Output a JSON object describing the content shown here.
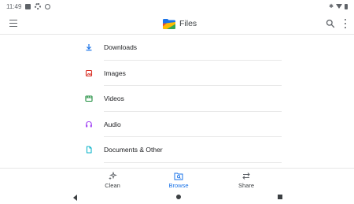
{
  "status_bar": {
    "time": "11:49",
    "left_icons": [
      "message-icon",
      "gear-icon",
      "at-icon"
    ],
    "right_icons": [
      "bluetooth-icon",
      "wifi-icon",
      "battery-icon"
    ]
  },
  "app_bar": {
    "title": "Files",
    "icons": [
      "menu-icon",
      "files-logo-icon",
      "search-icon",
      "more-vert-icon"
    ]
  },
  "colors": {
    "accent": "#1a73e8",
    "downloads": "#1a73e8",
    "images": "#d93025",
    "videos": "#1e8e3e",
    "audio": "#a142f4",
    "documents": "#12b5cb",
    "text": "#202124",
    "muted": "#5f6368"
  },
  "categories": [
    {
      "label": "Downloads",
      "icon": "download-icon"
    },
    {
      "label": "Images",
      "icon": "image-icon"
    },
    {
      "label": "Videos",
      "icon": "video-icon"
    },
    {
      "label": "Audio",
      "icon": "headphones-icon"
    },
    {
      "label": "Documents & Other",
      "icon": "document-icon"
    }
  ],
  "bottom_nav": {
    "items": [
      {
        "label": "Clean",
        "icon": "sparkle-icon",
        "selected": false
      },
      {
        "label": "Browse",
        "icon": "folder-search-icon",
        "selected": true
      },
      {
        "label": "Share",
        "icon": "swap-icon",
        "selected": false
      }
    ]
  },
  "system_nav": [
    "back-icon",
    "home-icon",
    "recents-icon"
  ]
}
